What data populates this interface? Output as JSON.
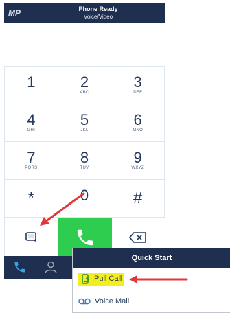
{
  "header": {
    "logo": "MP",
    "title": "Phone Ready",
    "subtitle": "Voice/Video"
  },
  "keypad": {
    "rows": [
      [
        {
          "num": "1",
          "letters": ""
        },
        {
          "num": "2",
          "letters": "ABC"
        },
        {
          "num": "3",
          "letters": "DEF"
        }
      ],
      [
        {
          "num": "4",
          "letters": "GHI"
        },
        {
          "num": "5",
          "letters": "JKL"
        },
        {
          "num": "6",
          "letters": "MNO"
        }
      ],
      [
        {
          "num": "7",
          "letters": "PQRS"
        },
        {
          "num": "8",
          "letters": "TUV"
        },
        {
          "num": "9",
          "letters": "WXYZ"
        }
      ],
      [
        {
          "num": "*",
          "letters": ""
        },
        {
          "num": "0",
          "letters": "+"
        },
        {
          "num": "#",
          "letters": ""
        }
      ]
    ]
  },
  "actions": {
    "message_icon": "message-icon",
    "call_icon": "phone-icon",
    "delete_icon": "backspace-icon",
    "call_color": "#2ecc4f"
  },
  "tabbar": {
    "tabs": [
      "phone-icon",
      "contacts-icon"
    ]
  },
  "quick_start": {
    "title": "Quick Start",
    "items": [
      {
        "label": "Pull Call",
        "icon": "pull-call-icon",
        "highlighted": true
      },
      {
        "label": "Voice Mail",
        "icon": "voicemail-icon",
        "highlighted": false
      }
    ]
  },
  "colors": {
    "navy": "#1f2f4f",
    "highlight": "#f3ee1e",
    "arrow": "#e0373a"
  }
}
